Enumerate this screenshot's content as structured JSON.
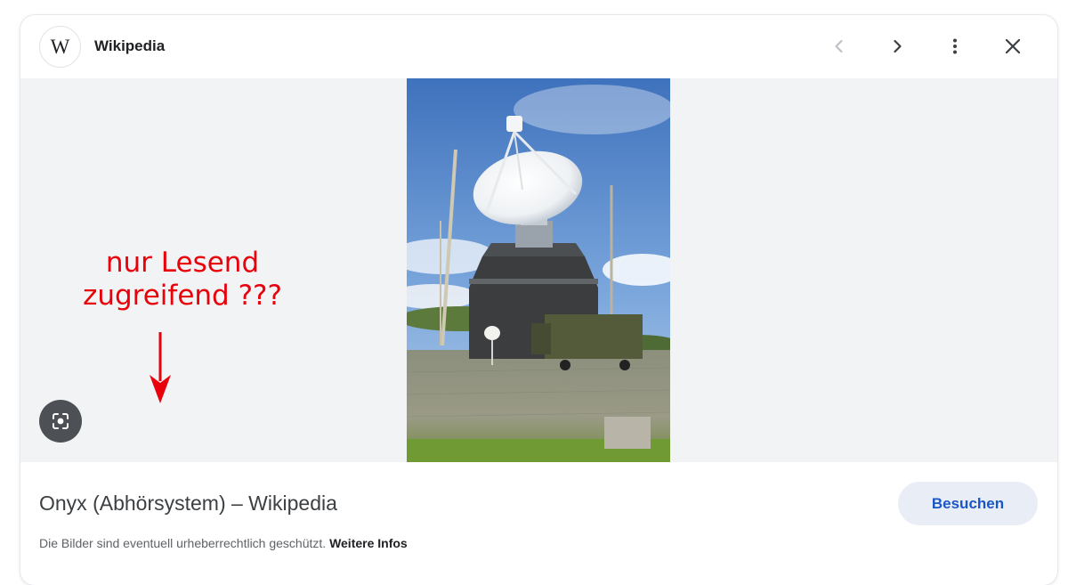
{
  "header": {
    "site_logo_letter": "W",
    "site_name": "Wikipedia",
    "icons": [
      "chevron-left-icon",
      "chevron-right-icon",
      "more-vert-icon",
      "close-icon"
    ]
  },
  "preview": {
    "image_subject": "satellite dish antenna with station building and military trailer",
    "lens_icon": "lens-search-icon"
  },
  "annotation": {
    "line1": "nur Lesend",
    "line2": "zugreifend ???",
    "color": "#e8000b"
  },
  "footer": {
    "page_title": "Onyx (Abhörsystem) – Wikipedia",
    "visit_label": "Besuchen",
    "copyright_text": "Die Bilder sind eventuell urheberrechtlich geschützt.",
    "more_info_label": "Weitere Infos"
  },
  "colors": {
    "accent": "#1a56c5",
    "button_bg": "#e9eef6",
    "stage_bg": "#f1f3f4"
  }
}
